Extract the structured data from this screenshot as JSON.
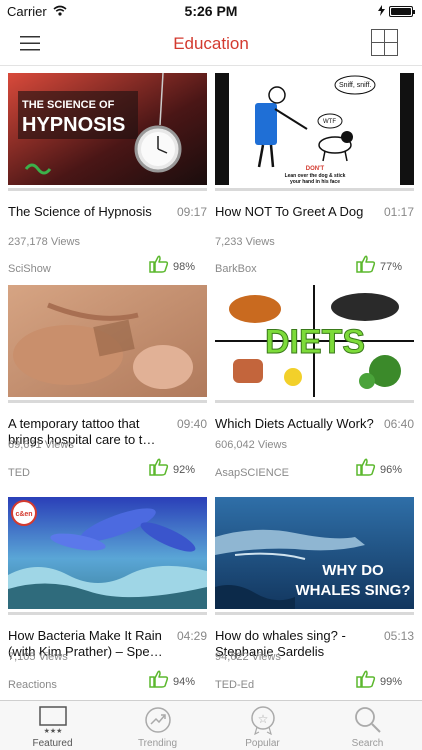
{
  "status_bar": {
    "carrier": "Carrier",
    "time": "5:26 PM"
  },
  "nav": {
    "title": "Education",
    "menu_icon": "hamburger-menu-icon",
    "layout_icon": "grid-layout-icon"
  },
  "videos": [
    {
      "title": "The Science of Hypnosis",
      "duration": "09:17",
      "views": "237,178 Views",
      "channel": "SciShow",
      "rating": "98%",
      "thumb_text": [
        "THE SCIENCE OF",
        "HYPNOSIS"
      ]
    },
    {
      "title": "How NOT To Greet A Dog",
      "duration": "01:17",
      "views": "7,233 Views",
      "channel": "BarkBox",
      "rating": "77%",
      "thumb_text": [
        "Sniff, sniff.",
        "WTF",
        "DON'T",
        "Lean over the dog & stick",
        "your hand in his face"
      ]
    },
    {
      "title": "A temporary tattoo that brings hospital care to t…",
      "duration": "09:40",
      "views": "69,671 Views",
      "channel": "TED",
      "rating": "92%"
    },
    {
      "title": "Which Diets Actually Work?",
      "duration": "06:40",
      "views": "606,042 Views",
      "channel": "AsapSCIENCE",
      "rating": "96%",
      "thumb_text": [
        "DIETS"
      ]
    },
    {
      "title": "How Bacteria Make It Rain (with Kim Prather) – Spe…",
      "duration": "04:29",
      "views": "7,105 Views",
      "channel": "Reactions",
      "rating": "94%",
      "thumb_text": [
        "c&en"
      ]
    },
    {
      "title": "How do whales sing? - Stephanie Sardelis",
      "duration": "05:13",
      "views": "94,622 Views",
      "channel": "TED-Ed",
      "rating": "99%",
      "thumb_text": [
        "WHY DO",
        "WHALES SING?"
      ]
    }
  ],
  "tabs": [
    {
      "label": "Featured",
      "icon": "featured-icon",
      "active": true
    },
    {
      "label": "Trending",
      "icon": "trending-icon",
      "active": false
    },
    {
      "label": "Popular",
      "icon": "popular-icon",
      "active": false
    },
    {
      "label": "Search",
      "icon": "search-icon",
      "active": false
    }
  ],
  "colors": {
    "accent": "#d33a2f",
    "like": "#5cb82e"
  }
}
